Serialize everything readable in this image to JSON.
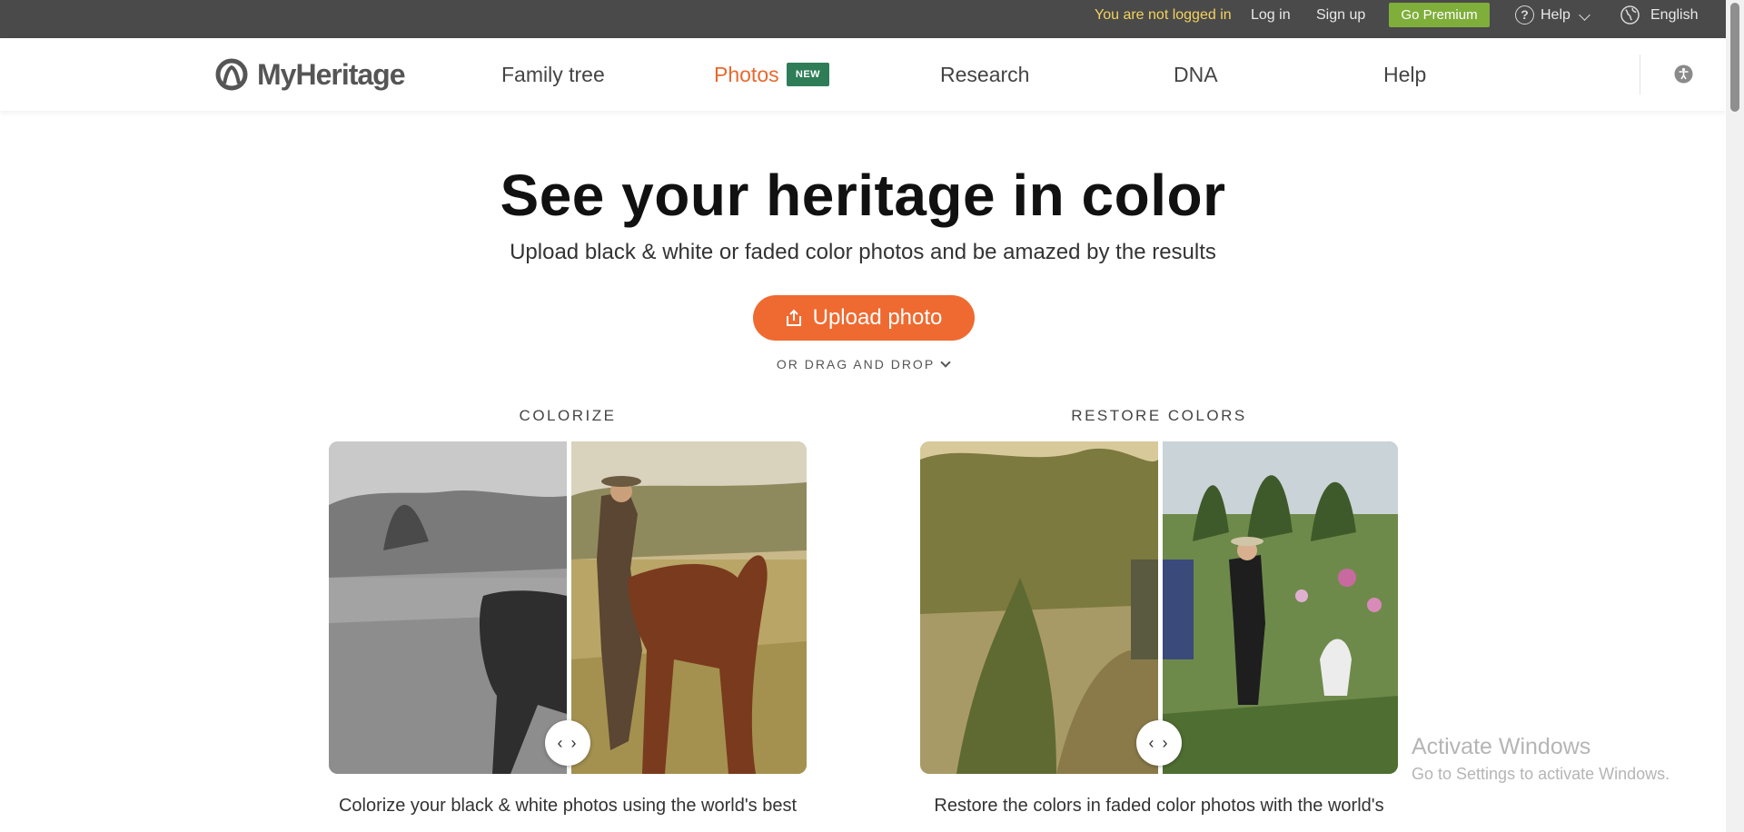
{
  "topbar": {
    "not_logged_in": "You are not logged in",
    "login": "Log in",
    "signup": "Sign up",
    "premium": "Go Premium",
    "help": "Help",
    "language": "English"
  },
  "nav": {
    "logo": "MyHeritage",
    "items": {
      "family_tree": "Family tree",
      "photos": "Photos",
      "photos_badge": "NEW",
      "research": "Research",
      "dna": "DNA",
      "help": "Help"
    }
  },
  "hero": {
    "title": "See your heritage in color",
    "subtitle": "Upload black & white or faded color photos and be amazed by the results",
    "upload_button": "Upload photo",
    "drag_drop": "OR DRAG AND DROP"
  },
  "cards": [
    {
      "label": "COLORIZE",
      "description": "Colorize your black & white photos using the world's best",
      "compare_glyph": "‹ ›"
    },
    {
      "label": "RESTORE COLORS",
      "description": "Restore the colors in faded color photos with the world's",
      "compare_glyph": "‹ ›"
    }
  ],
  "watermark": {
    "title": "Activate Windows",
    "subtitle": "Go to Settings to activate Windows."
  },
  "colors": {
    "accent": "#ef6a30",
    "premium_green": "#7fae3b",
    "new_badge": "#2e7d57",
    "topbar_bg": "#4a4a4a"
  }
}
